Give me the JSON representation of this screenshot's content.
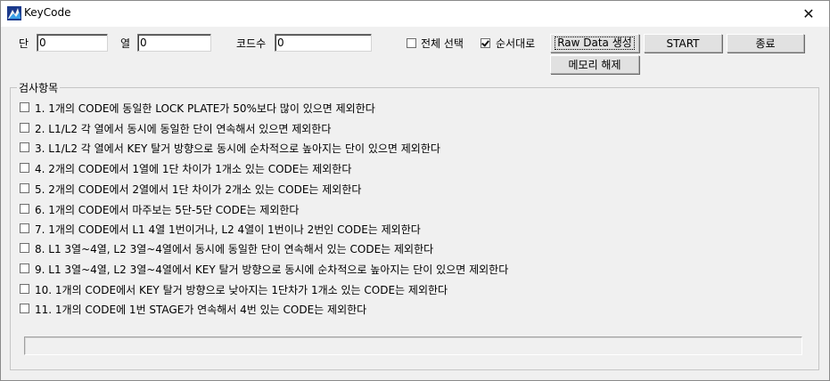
{
  "window": {
    "title": "KeyCode",
    "close_glyph": "✕",
    "app_icon": "keycode-app-icon"
  },
  "fields": {
    "dan_label": "단",
    "dan_value": "0",
    "yeol_label": "열",
    "yeol_value": "0",
    "codesu_label": "코드수",
    "codesu_value": "0"
  },
  "options": {
    "select_all_label": "전체 선택",
    "select_all_checked": false,
    "in_order_label": "순서대로",
    "in_order_checked": true
  },
  "buttons": {
    "raw_data": "Raw Data 생성",
    "start": "START",
    "exit": "종료",
    "free_memory": "메모리 해제"
  },
  "group": {
    "title": "검사항목",
    "items": [
      {
        "label": "1. 1개의 CODE에 동일한 LOCK PLATE가 50%보다 많이 있으면 제외한다",
        "checked": false
      },
      {
        "label": "2. L1/L2 각 열에서 동시에 동일한 단이 연속해서 있으면 제외한다",
        "checked": false
      },
      {
        "label": "3. L1/L2 각 열에서 KEY 탈거 방향으로 동시에 순차적으로 높아지는 단이 있으면 제외한다",
        "checked": false
      },
      {
        "label": "4. 2개의 CODE에서 1열에 1단 차이가 1개소 있는 CODE는 제외한다",
        "checked": false
      },
      {
        "label": "5. 2개의 CODE에서 2열에서 1단 차이가 2개소 있는 CODE는 제외한다",
        "checked": false
      },
      {
        "label": "6. 1개의 CODE에서 마주보는 5단-5단 CODE는 제외한다",
        "checked": false
      },
      {
        "label": "7. 1개의 CODE에서 L1 4열 1번이거나, L2 4열이 1번이나 2번인 CODE는 제외한다",
        "checked": false
      },
      {
        "label": "8. L1 3열~4열, L2 3열~4열에서 동시에 동일한 단이 연속해서 있는 CODE는 제외한다",
        "checked": false
      },
      {
        "label": "9. L1 3열~4열, L2 3열~4열에서 KEY 탈거 방향으로 동시에 순차적으로 높아지는 단이 있으면 제외한다",
        "checked": false
      },
      {
        "label": "10. 1개의 CODE에서 KEY 탈거 방향으로 낮아지는 1단차가 1개소 있는 CODE는 제외한다",
        "checked": false
      },
      {
        "label": "11. 1개의 CODE에 1번 STAGE가 연속해서 4번 있는 CODE는 제외한다",
        "checked": false
      }
    ]
  },
  "status_text": ""
}
